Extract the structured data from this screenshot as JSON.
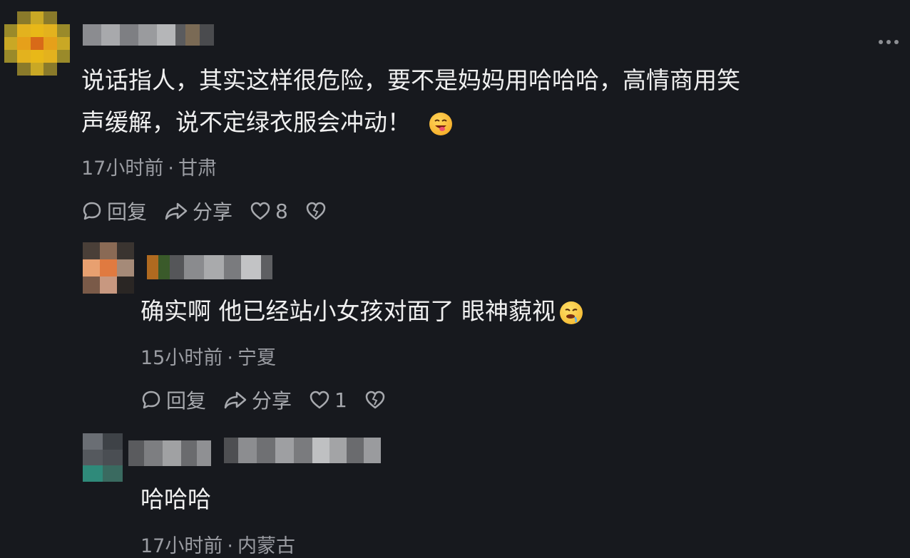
{
  "comments": [
    {
      "text_line1": "说话指人，其实这样很危险，要不是妈妈用哈哈哈，高情商用笑",
      "text_line2": "声缓解，说不定绿衣服会冲动！",
      "time": "17小时前",
      "location": "甘肃",
      "reply_label": "回复",
      "share_label": "分享",
      "like_count": "8",
      "emoji": "grinning-tongue-emoji"
    },
    {
      "text": "确实啊 他已经站小女孩对面了 眼神藐视",
      "time": "15小时前",
      "location": "宁夏",
      "reply_label": "回复",
      "share_label": "分享",
      "like_count": "1",
      "emoji": "drooling-face-emoji"
    },
    {
      "text": "哈哈哈",
      "time": "17小时前",
      "location": "内蒙古"
    }
  ],
  "separator": "·",
  "colors": {
    "background": "#17191e",
    "text": "#f0f0f0",
    "meta": "#9a9ca2"
  }
}
